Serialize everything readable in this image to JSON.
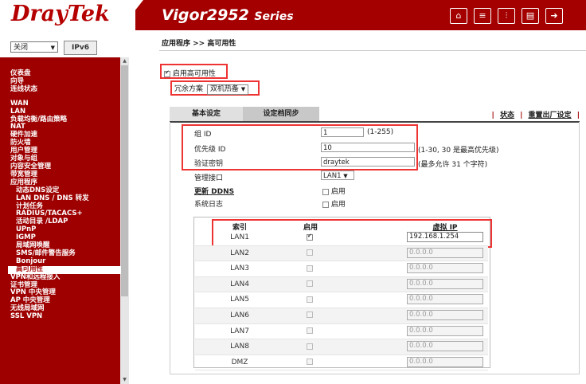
{
  "header": {
    "logo": "DrayTek",
    "model": "Vigor2952",
    "series": "Series",
    "icons": [
      "home-icon",
      "list-icon",
      "sliders-icon",
      "save-icon",
      "logout-icon"
    ]
  },
  "sidebar": {
    "language": "关闭",
    "ipv6_badge": "IPv6",
    "items": [
      {
        "label": "仪表盘"
      },
      {
        "label": "向导"
      },
      {
        "label": "连线状态"
      },
      {
        "label": "WAN",
        "gap": true
      },
      {
        "label": "LAN"
      },
      {
        "label": "负载均衡/路由策略"
      },
      {
        "label": "NAT"
      },
      {
        "label": "硬件加速"
      },
      {
        "label": "防火墙"
      },
      {
        "label": "用户管理"
      },
      {
        "label": "对象与组"
      },
      {
        "label": "内容安全管理"
      },
      {
        "label": "带宽管理"
      },
      {
        "label": "应用程序"
      },
      {
        "label": "动态DNS设定",
        "sub": true
      },
      {
        "label": "LAN DNS / DNS 转发",
        "sub": true
      },
      {
        "label": "计划任务",
        "sub": true
      },
      {
        "label": "RADIUS/TACACS+",
        "sub": true
      },
      {
        "label": "活动目录 /LDAP",
        "sub": true
      },
      {
        "label": "UPnP",
        "sub": true
      },
      {
        "label": "IGMP",
        "sub": true
      },
      {
        "label": "局域网唤醒",
        "sub": true
      },
      {
        "label": "SMS/邮件警告服务",
        "sub": true
      },
      {
        "label": "Bonjour",
        "sub": true
      },
      {
        "label": "高可用性",
        "sub": true,
        "active": true
      },
      {
        "label": "VPN和远程接入"
      },
      {
        "label": "证书管理"
      },
      {
        "label": "VPN 中央管理"
      },
      {
        "label": "AP 中央管理"
      },
      {
        "label": "无线局域网"
      },
      {
        "label": "SSL VPN"
      }
    ]
  },
  "main": {
    "breadcrumb": "应用程序 >> 高可用性",
    "enable_ha_label": "启用高可用性",
    "enable_ha_checked": true,
    "redundancy_label": "冗余方案",
    "redundancy_value": "双机热备",
    "tabs": {
      "basic": "基本设定",
      "sync": "设定档同步"
    },
    "links": {
      "status": "状态",
      "factory": "重置出厂设定"
    },
    "form": {
      "group_id_label": "组 ID",
      "group_id_value": "1",
      "group_id_hint": "(1-255)",
      "priority_label": "优先级 ID",
      "priority_value": "10",
      "priority_hint": "(1-30, 30 是最高优先级)",
      "auth_label": "验证密钥",
      "auth_value": "draytek",
      "auth_hint": "(最多允许 31 个字符)",
      "mgmt_label": "管理接口",
      "mgmt_value": "LAN1",
      "ddns_label": "更新 DDNS",
      "ddns_enable": "启用",
      "syslog_label": "系统日志",
      "syslog_enable": "启用"
    },
    "table": {
      "headers": {
        "index": "索引",
        "enable": "启用",
        "vip": "虚拟 IP"
      },
      "rows": [
        {
          "name": "LAN1",
          "checked": true,
          "ip": "192.168.1.254",
          "active": true
        },
        {
          "name": "LAN2",
          "checked": false,
          "ip": "0.0.0.0"
        },
        {
          "name": "LAN3",
          "checked": false,
          "ip": "0.0.0.0"
        },
        {
          "name": "LAN4",
          "checked": false,
          "ip": "0.0.0.0"
        },
        {
          "name": "LAN5",
          "checked": false,
          "ip": "0.0.0.0"
        },
        {
          "name": "LAN6",
          "checked": false,
          "ip": "0.0.0.0"
        },
        {
          "name": "LAN7",
          "checked": false,
          "ip": "0.0.0.0"
        },
        {
          "name": "LAN8",
          "checked": false,
          "ip": "0.0.0.0"
        },
        {
          "name": "DMZ",
          "checked": false,
          "ip": "0.0.0.0"
        }
      ]
    }
  },
  "colors": {
    "brand": "#a40000",
    "highlight": "#e33333"
  }
}
